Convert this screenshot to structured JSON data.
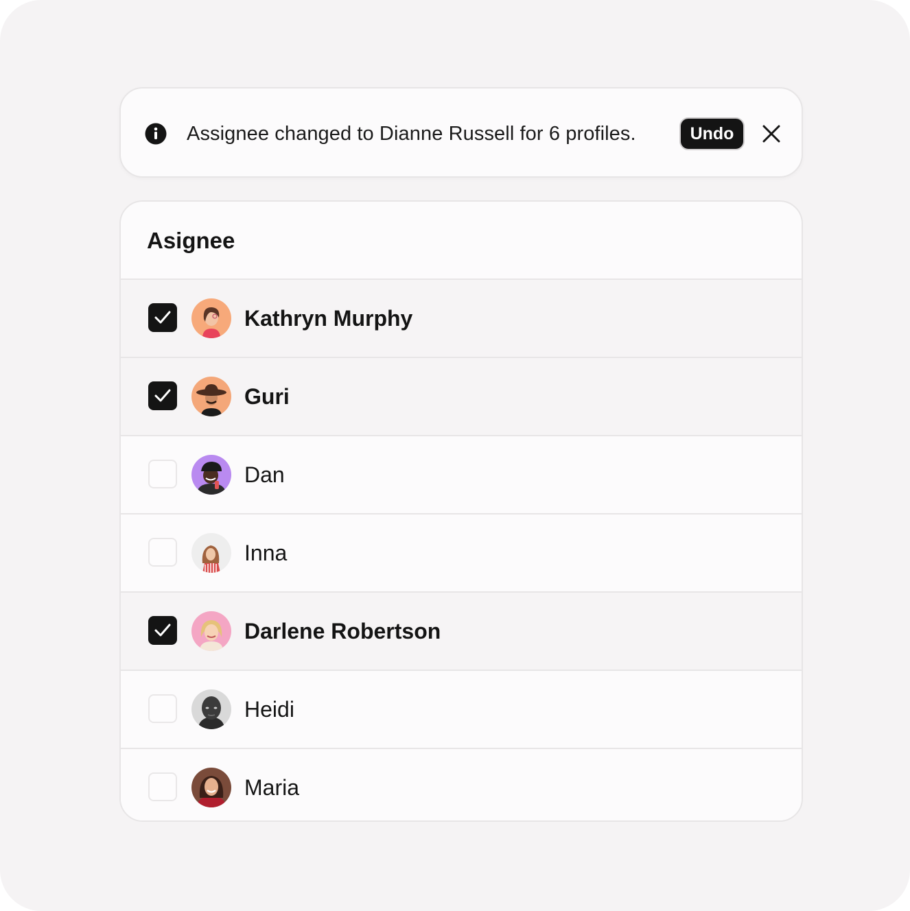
{
  "toast": {
    "icon": "info-icon",
    "message": "Assignee changed to Dianne Russell for 6 profiles.",
    "undo_label": "Undo",
    "close_icon": "close-icon"
  },
  "panel": {
    "title": "Asignee",
    "items": [
      {
        "name": "Kathryn Murphy",
        "checked": true,
        "avatar_bg": "#f7a97a"
      },
      {
        "name": "Guri",
        "checked": true,
        "avatar_bg": "#f4a779"
      },
      {
        "name": "Dan",
        "checked": false,
        "avatar_bg": "#b98af0"
      },
      {
        "name": "Inna",
        "checked": false,
        "avatar_bg": "#eeeeee"
      },
      {
        "name": "Darlene Robertson",
        "checked": true,
        "avatar_bg": "#f4a6c4"
      },
      {
        "name": "Heidi",
        "checked": false,
        "avatar_bg": "#d9d9d9"
      },
      {
        "name": "Maria",
        "checked": false,
        "avatar_bg": "#7a4b3a"
      }
    ]
  },
  "colors": {
    "accent": "#141414",
    "border": "#e7e5e6",
    "background": "#f5f3f4"
  }
}
